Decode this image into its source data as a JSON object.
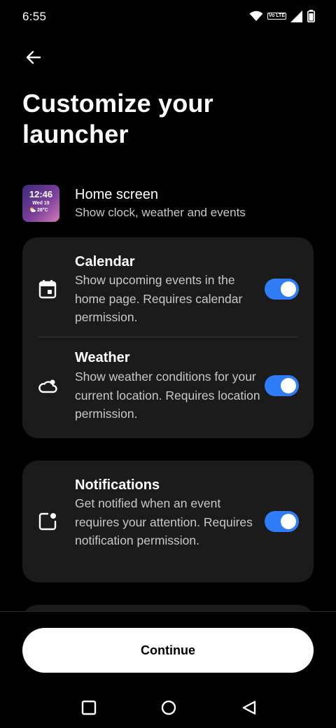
{
  "status_bar": {
    "time": "6:55",
    "volte_label": "Vo LTE",
    "icons": [
      "wifi-icon",
      "volte-icon",
      "signal-icon",
      "battery-icon"
    ]
  },
  "header": {
    "back_icon": "arrow-back-icon",
    "title": "Customize your launcher"
  },
  "home_screen": {
    "title": "Home screen",
    "subtitle": "Show clock, weather and events",
    "widget": {
      "time": "12:46",
      "date": "Wed 19",
      "temp": "28°C"
    }
  },
  "settings": [
    {
      "title": "Calendar",
      "description": "Show upcoming events in the home page. Requires calendar permission.",
      "icon": "calendar-icon",
      "enabled": true
    },
    {
      "title": "Weather",
      "description": "Show weather conditions for your current location. Requires location permission.",
      "icon": "cloud-icon",
      "enabled": true
    },
    {
      "title": "Notifications",
      "description": "Get notified when an event requires your attention. Requires notification permission.",
      "icon": "notification-icon",
      "enabled": true
    }
  ],
  "footer": {
    "continue_label": "Continue"
  },
  "navbar": {
    "icons": [
      "recents-icon",
      "home-icon",
      "back-icon"
    ]
  },
  "colors": {
    "background": "#000000",
    "card": "#1b1b1b",
    "accent": "#2f7cf6",
    "button": "#ffffff"
  }
}
